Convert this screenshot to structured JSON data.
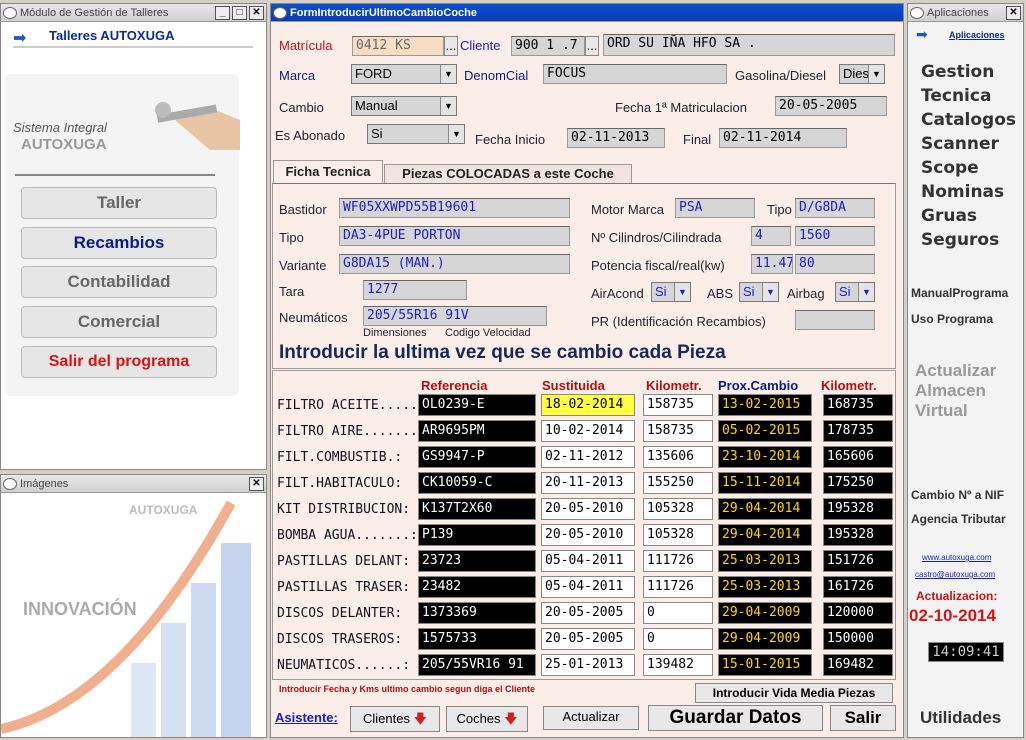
{
  "left_window": {
    "title": "Módulo de Gestión de Talleres",
    "header": "Talleres AUTOXUGA",
    "system_line1": "Sistema Integral",
    "system_line2": "AUTOXUGA",
    "nav": [
      {
        "label": "Taller"
      },
      {
        "label": "Recambios"
      },
      {
        "label": "Contabilidad"
      },
      {
        "label": "Comercial"
      },
      {
        "label": "Salir del programa"
      }
    ],
    "colors": {
      "recambios": "#0a1a8a",
      "salir": "#dd1111"
    }
  },
  "images_window": {
    "title": "Imágenes",
    "brand": "AUTOXUGA",
    "caption": "INNOVACIÓN"
  },
  "form": {
    "title": "FormIntroducirUltimoCambioCoche",
    "matricula_label": "Matrícula",
    "matricula": "0412  KS",
    "cliente_label": "Cliente",
    "cliente_code": "900  1 .7",
    "cliente_name": "ORD  SU  IÑA  HFO  SA .",
    "marca_label": "Marca",
    "marca": "FORD",
    "denom_label": "DenomCial",
    "denom": "FOCUS",
    "fuel_label": "Gasolina/Diesel",
    "fuel": "Dies",
    "cambio_label": "Cambio",
    "cambio": "Manual",
    "fecha1_label": "Fecha 1ª Matriculacion",
    "fecha1": "20-05-2005",
    "abonado_label": "Es Abonado",
    "abonado": "Si",
    "inicio_label": "Fecha Inicio",
    "inicio": "02-11-2013",
    "final_label": "Final",
    "final": "02-11-2014",
    "tabs": [
      "Ficha Tecnica",
      "Piezas COLOCADAS a este Coche"
    ],
    "bastidor_label": "Bastidor",
    "bastidor": "WF05XXWPD55B19601",
    "motor_label": "Motor Marca",
    "motor": "PSA",
    "tipo_m_label": "Tipo",
    "tipo_m": "D/G8DA",
    "tipo_label": "Tipo",
    "tipo": "DA3-4PUE PORTON",
    "cil_label": "Nº Cilindros/Cilindrada",
    "cil": "4",
    "cc": "1560",
    "variante_label": "Variante",
    "variante": "G8DA15 (MAN.)",
    "pot_label": "Potencia fiscal/real(kw)",
    "pot_f": "11.47",
    "pot_r": "80",
    "tara_label": "Tara",
    "tara": "1277",
    "air_label": "AirAcond",
    "air": "Si",
    "abs_label": "ABS",
    "abs": "Si",
    "airbag_label": "Airbag",
    "airbag": "Si",
    "neum_label": "Neumáticos",
    "neum": "205/55R16 91V",
    "dim_label": "Dimensiones",
    "vel_label": "Codigo Velocidad",
    "pr_label": "PR (Identificación Recambios)",
    "heading": "Introducir la ultima vez que se cambio cada Pieza",
    "col_headers": [
      "Referencia",
      "Sustituida",
      "Kilometr.",
      "Prox.Cambio",
      "Kilometr."
    ],
    "rows": [
      {
        "name": "FILTRO ACEITE.....:",
        "ref": "OL0239-E",
        "date": "18-02-2014",
        "km": "158735",
        "prox": "13-02-2015",
        "km2": "168735"
      },
      {
        "name": "FILTRO AIRE.........:",
        "ref": "AR9695PM",
        "date": "10-02-2014",
        "km": "158735",
        "prox": "05-02-2015",
        "km2": "178735"
      },
      {
        "name": "FILT.COMBUSTIB.:",
        "ref": "GS9947-P",
        "date": "02-11-2012",
        "km": "135606",
        "prox": "23-10-2014",
        "km2": "165606"
      },
      {
        "name": "FILT.HABITACULO:",
        "ref": "CK10059-C",
        "date": "20-11-2013",
        "km": "155250",
        "prox": "15-11-2014",
        "km2": "175250"
      },
      {
        "name": "KIT DISTRIBUCION:",
        "ref": "K137T2X60",
        "date": "20-05-2010",
        "km": "105328",
        "prox": "29-04-2014",
        "km2": "195328"
      },
      {
        "name": "BOMBA AGUA.......:",
        "ref": "P139",
        "date": "20-05-2010",
        "km": "105328",
        "prox": "29-04-2014",
        "km2": "195328"
      },
      {
        "name": "PASTILLAS DELANT:",
        "ref": "23723",
        "date": "05-04-2011",
        "km": "111726",
        "prox": "25-03-2013",
        "km2": "151726"
      },
      {
        "name": "PASTILLAS TRASER:",
        "ref": "23482",
        "date": "05-04-2011",
        "km": "111726",
        "prox": "25-03-2013",
        "km2": "161726"
      },
      {
        "name": "DISCOS DELANTER:",
        "ref": "1373369",
        "date": "20-05-2005",
        "km": "0",
        "prox": "29-04-2009",
        "km2": "120000"
      },
      {
        "name": "DISCOS TRASEROS:",
        "ref": "1575733",
        "date": "20-05-2005",
        "km": "0",
        "prox": "29-04-2009",
        "km2": "150000"
      },
      {
        "name": "NEUMATICOS......:",
        "ref": "205/55VR16 91",
        "date": "25-01-2013",
        "km": "139482",
        "prox": "15-01-2015",
        "km2": "169482"
      }
    ],
    "note": "Introducir Fecha y Kms ultimo cambio segun diga el Cliente",
    "vida_btn": "Introducir Vida Media Piezas",
    "asistente": "Asistente:",
    "clientes_btn": "Clientes",
    "coches_btn": "Coches",
    "actualizar_btn": "Actualizar",
    "guardar_btn": "Guardar Datos",
    "salir_btn": "Salir"
  },
  "apps": {
    "title": "Aplicaciones",
    "header": "Aplicaciones",
    "items": [
      "Gestion",
      "Tecnica",
      "Catalogos",
      "Scanner",
      "Scope",
      "Nominas",
      "Gruas",
      "Seguros"
    ],
    "manual": "ManualPrograma",
    "uso": "Uso Programa",
    "almacen1": "Actualizar",
    "almacen2": "Almacen",
    "almacen3": "Virtual",
    "nif1": "Cambio Nº a NIF",
    "nif2": "Agencia Tributar",
    "web": "www.autoxuga.com",
    "email": "castro@autoxuga.com",
    "act_label": "Actualizacion:",
    "act_date": "02-10-2014",
    "clock": "14:09:41",
    "utilidades": "Utilidades"
  }
}
